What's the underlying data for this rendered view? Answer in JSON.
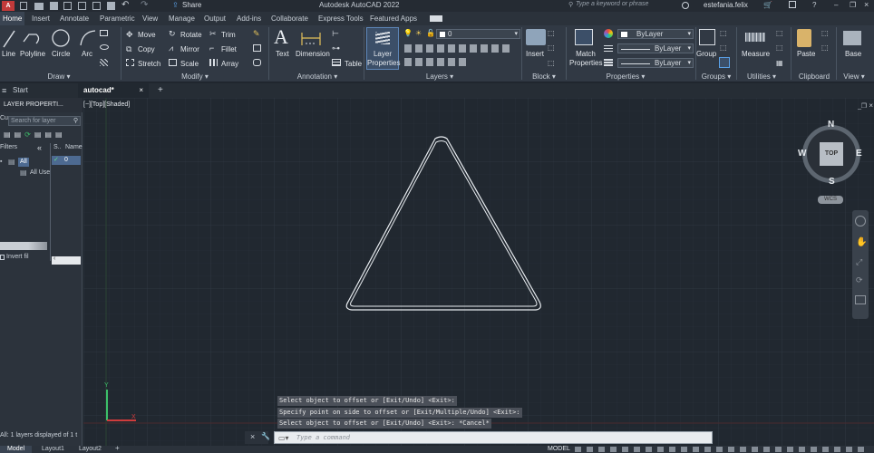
{
  "app": {
    "title": "Autodesk AutoCAD 2022",
    "share_label": "Share",
    "search_placeholder": "Type a keyword or phrase",
    "user": "estefania.felix"
  },
  "ribbon_tabs": [
    "Home",
    "Insert",
    "Annotate",
    "Parametric",
    "View",
    "Manage",
    "Output",
    "Add-ins",
    "Collaborate",
    "Express Tools",
    "Featured Apps"
  ],
  "draw": {
    "line": "Line",
    "polyline": "Polyline",
    "circle": "Circle",
    "arc": "Arc",
    "panel": "Draw ▾"
  },
  "modify": {
    "move": "Move",
    "rotate": "Rotate",
    "trim": "Trim",
    "copy": "Copy",
    "mirror": "Mirror",
    "fillet": "Fillet",
    "stretch": "Stretch",
    "scale": "Scale",
    "array": "Array",
    "panel": "Modify ▾"
  },
  "annotation": {
    "text": "Text",
    "dimension": "Dimension",
    "table": "Table",
    "panel": "Annotation ▾"
  },
  "layers": {
    "layer_properties_line1": "Layer",
    "layer_properties_line2": "Properties",
    "current_layer": "0",
    "panel": "Layers ▾"
  },
  "block": {
    "insert": "Insert",
    "panel": "Block ▾"
  },
  "properties": {
    "match_line1": "Match",
    "match_line2": "Properties",
    "color": "ByLayer",
    "linetype": "ByLayer",
    "lineweight": "ByLayer",
    "panel": "Properties ▾"
  },
  "groups": {
    "group": "Group",
    "panel": "Groups ▾"
  },
  "utilities": {
    "measure": "Measure",
    "panel": "Utilities ▾"
  },
  "clipboard": {
    "paste": "Paste",
    "panel": "Clipboard"
  },
  "view": {
    "base": "Base",
    "panel": "View ▾"
  },
  "doc_tabs": {
    "start": "Start",
    "active": "autocad*"
  },
  "layer_panel": {
    "title": "LAYER PROPERTI...",
    "cur": "Cur",
    "search_placeholder": "Search for layer",
    "filters": "Filters",
    "col_status": "S..",
    "col_name": "Name",
    "all": "All",
    "all_used": "All Use",
    "layer_row_name": "0",
    "invert_filter": "Invert fil",
    "status_text": "All: 1 layers displayed of 1 t"
  },
  "viewport": {
    "label": "[−][Top][Shaded]",
    "viewcube_top": "TOP",
    "compass": {
      "n": "N",
      "s": "S",
      "e": "E",
      "w": "W"
    },
    "wcs": "WCS"
  },
  "command": {
    "history": [
      "Select object to offset or [Exit/Undo] <Exit>:",
      "Specify point on side to offset or [Exit/Multiple/Undo] <Exit>:",
      "Select object to offset or [Exit/Undo] <Exit>: *Cancel*"
    ],
    "placeholder": "Type a command"
  },
  "layout_tabs": {
    "model": "Model",
    "layout1": "Layout1",
    "layout2": "Layout2"
  },
  "status": {
    "mode": "MODEL"
  },
  "colors": {
    "accent": "#3c8ad6",
    "background": "#212830",
    "ribbon": "#313944"
  }
}
